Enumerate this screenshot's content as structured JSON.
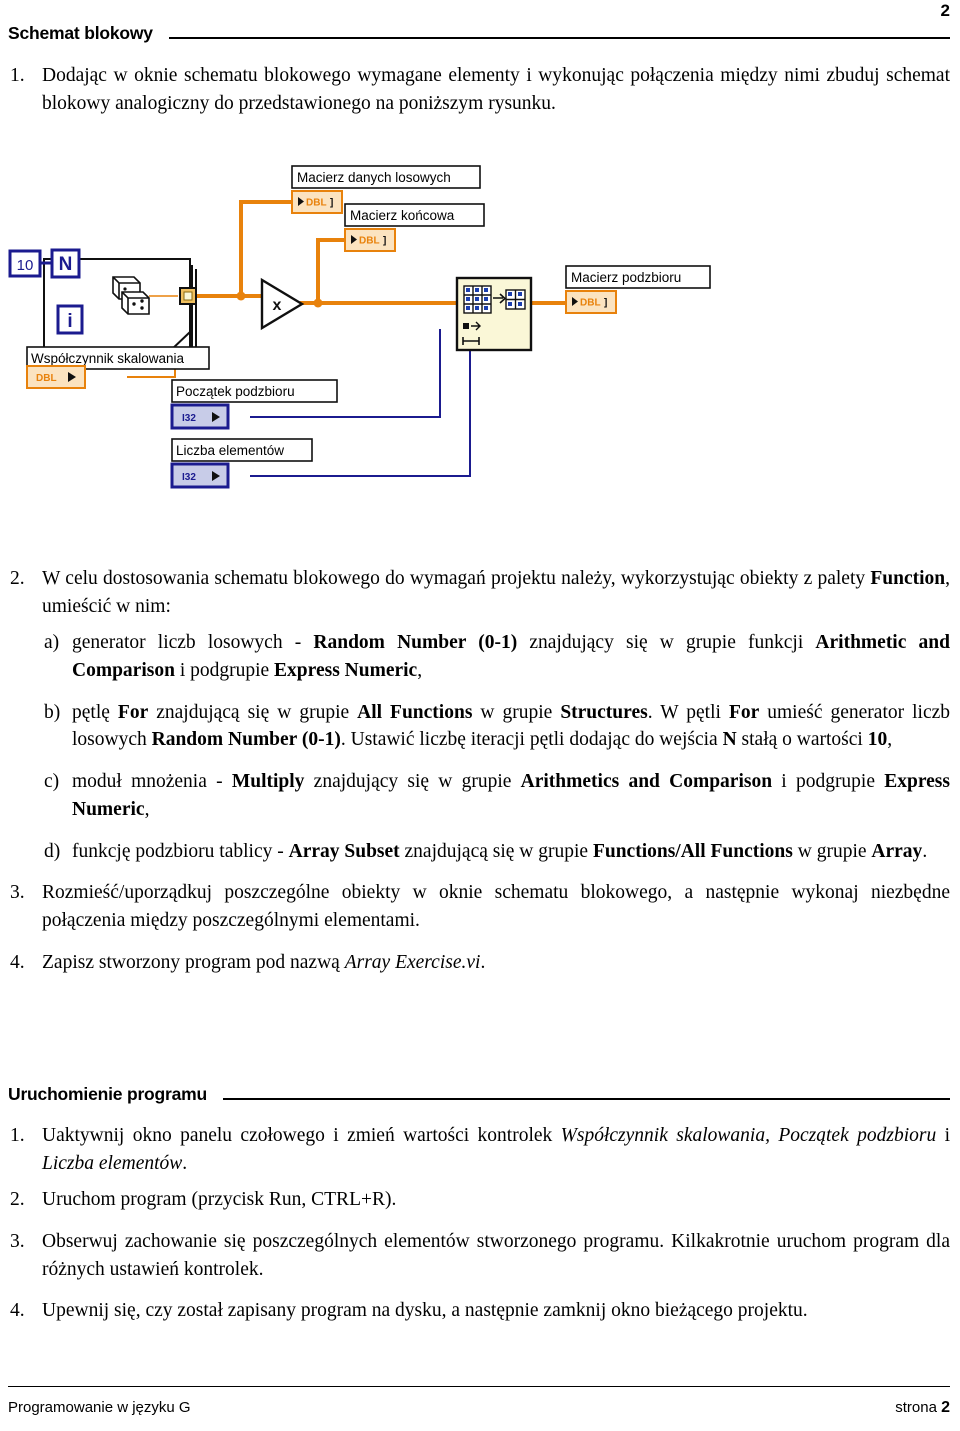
{
  "page": {
    "number_top": "2",
    "footer_left": "Programowanie w języku G",
    "footer_right_label": "strona",
    "footer_right_number": "2"
  },
  "sections": [
    {
      "title": "Schemat blokowy"
    },
    {
      "title": "Uruchomienie programu"
    }
  ],
  "schemat_items": {
    "i1_marker": "1.",
    "i1_text": "Dodając w oknie schematu blokowego wymagane elementy i wykonując połączenia między nimi zbuduj schemat blokowy analogiczny do przedstawionego na poniższym rysunku.",
    "i2_marker": "2.",
    "i2_text_a": "W celu dostosowania schematu blokowego do wymagań projektu należy, wykorzystując obiekty z palety ",
    "i2_bold_function": "Function",
    "i2_text_b": ", umieścić w nim:",
    "a_marker": "a)",
    "a_t1": "generator liczb losowych - ",
    "a_b1": "Random Number (0-1)",
    "a_t2": " znajdujący się w grupie funkcji ",
    "a_b2": "Arithmetic and Comparison",
    "a_t3": " i podgrupie ",
    "a_b3": "Express Numeric",
    "a_t4": ",",
    "b_marker": "b)",
    "b_t1": "pętlę ",
    "b_b1": "For",
    "b_t2": " znajdującą się w grupie ",
    "b_b2": "All Functions",
    "b_t3": " w grupie ",
    "b_b3": "Structures",
    "b_t4": ". W pętli ",
    "b_b4": "For",
    "b_t5": " umieść generator liczb losowych ",
    "b_b5": "Random Number (0-1)",
    "b_t6": ". Ustawić liczbę iteracji pętli dodając do wejścia ",
    "b_b6": "N",
    "b_t7": " stałą o wartości ",
    "b_b7": "10",
    "b_t8": ",",
    "c_marker": "c)",
    "c_t1": "moduł mnożenia - ",
    "c_b1": "Multiply",
    "c_t2": " znajdujący się w grupie ",
    "c_b2": "Arithmetics and Comparison",
    "c_t3": " i podgrupie ",
    "c_b3": "Express Numeric",
    "c_t4": ",",
    "d_marker": "d)",
    "d_t1": "funkcję podzbioru tablicy - ",
    "d_b1": "Array Subset",
    "d_t2": " znajdującą się w grupie ",
    "d_b2": "Functions/All Functions",
    "d_t3": " w grupie ",
    "d_b3": "Array",
    "d_t4": ".",
    "i3_marker": "3.",
    "i3_text": "Rozmieść/uporządkuj poszczególne obiekty w oknie schematu blokowego, a następnie wykonaj niezbędne połączenia między poszczególnymi elementami.",
    "i4_marker": "4.",
    "i4_t1": "Zapisz stworzony program pod nazwą ",
    "i4_i1": "Array Exercise.vi",
    "i4_t2": "."
  },
  "uruchomienie_items": {
    "u1_marker": "1.",
    "u1_t1": "Uaktywnij okno panelu czołowego i zmień wartości kontrolek ",
    "u1_i1": "Współczynnik skalowania, Początek podzbioru",
    "u1_t2": " i ",
    "u1_i2": "Liczba elementów",
    "u1_t3": ".",
    "u2_marker": "2.",
    "u2_text": "Uruchom program (przycisk Run, CTRL+R).",
    "u3_marker": "3.",
    "u3_text": "Obserwuj zachowanie się poszczególnych elementów stworzonego programu. Kilkakrotnie uruchom program dla różnych ustawień kontrolek.",
    "u4_marker": "4.",
    "u4_text": "Upewnij się, czy został zapisany program na dysku, a następnie zamknij okno bieżącego projektu."
  },
  "diagram": {
    "constant_10": "10",
    "loop_count_terminal": "N",
    "loop_iterator_terminal": "i",
    "multiply_symbol": "x",
    "label_macierz_danych": "Macierz danych losowych",
    "label_macierz_koncowa": "Macierz końcowa",
    "label_macierz_podzbioru": "Macierz podzbioru",
    "label_wspolczynnik": "Współczynnik skalowania",
    "label_poczatek": "Początek podzbioru",
    "label_liczba": "Liczba elementów",
    "type_dbl": "DBL",
    "type_i32": "I32",
    "colors": {
      "wire_orange": "#E8820C",
      "wire_blue": "#1B1B8F",
      "terminal_orange_fill": "#FBE3C0",
      "terminal_orange_border": "#E8820C",
      "terminal_blue_fill": "#C8CCE8",
      "terminal_blue_border": "#1B1B8F",
      "node_fill": "#FAF7D7",
      "label_bg": "#FFFFFF",
      "structure_border": "#101010"
    }
  }
}
